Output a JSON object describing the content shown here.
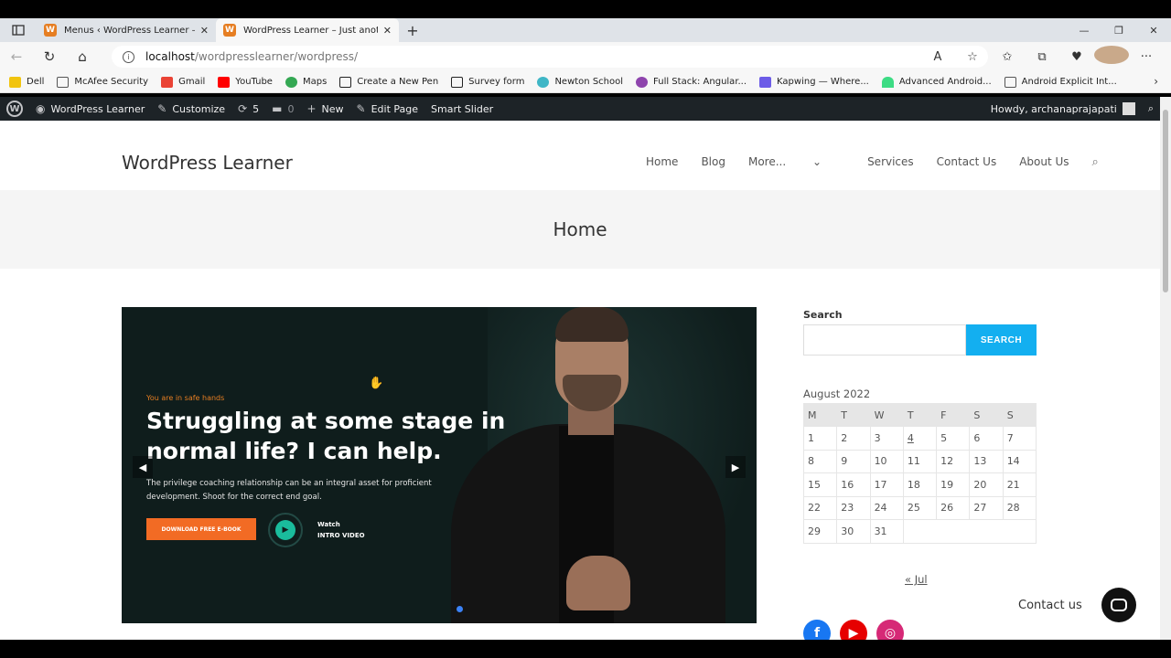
{
  "browser": {
    "tabs": [
      {
        "title": "Menus ‹ WordPress Learner — W",
        "active": false
      },
      {
        "title": "WordPress Learner – Just anothe",
        "active": true
      }
    ],
    "url_host": "localhost",
    "url_path": "/wordpresslearner/wordpress/",
    "bookmarks": [
      "Dell",
      "McAfee Security",
      "Gmail",
      "YouTube",
      "Maps",
      "Create a New Pen",
      "Survey form",
      "Newton School",
      "Full Stack: Angular...",
      "Kapwing — Where...",
      "Advanced Android...",
      "Android Explicit Int..."
    ]
  },
  "wpbar": {
    "site": "WordPress Learner",
    "customize": "Customize",
    "updates": "5",
    "comments": "0",
    "new": "New",
    "edit_page": "Edit Page",
    "smart_slider": "Smart Slider",
    "howdy": "Howdy, archanaprajapati"
  },
  "site": {
    "title": "WordPress Learner",
    "nav": [
      "Home",
      "Blog",
      "More...",
      "Services",
      "Contact Us",
      "About Us"
    ],
    "page_title": "Home"
  },
  "slider": {
    "tagline": "You are in safe hands",
    "headline": "Struggling at some stage in normal life? I can help.",
    "description": "The privilege coaching relationship can be an integral asset for proficient development. Shoot for the correct end goal.",
    "button": "DOWNLOAD FREE E-BOOK",
    "watch_line1": "Watch",
    "watch_line2": "INTRO VIDEO"
  },
  "sidebar": {
    "search_label": "Search",
    "search_button": "SEARCH",
    "calendar_caption": "August 2022",
    "weekdays": [
      "M",
      "T",
      "W",
      "T",
      "F",
      "S",
      "S"
    ],
    "weeks": [
      [
        "1",
        "2",
        "3",
        "4",
        "5",
        "6",
        "7"
      ],
      [
        "8",
        "9",
        "10",
        "11",
        "12",
        "13",
        "14"
      ],
      [
        "15",
        "16",
        "17",
        "18",
        "19",
        "20",
        "21"
      ],
      [
        "22",
        "23",
        "24",
        "25",
        "26",
        "27",
        "28"
      ],
      [
        "29",
        "30",
        "31",
        "",
        "",
        "",
        ""
      ]
    ],
    "prev_month": "« Jul"
  },
  "contact": {
    "label": "Contact us"
  },
  "colors": {
    "accent": "#13aff0",
    "wpbar": "#1d2327",
    "cta": "#f26b24"
  }
}
